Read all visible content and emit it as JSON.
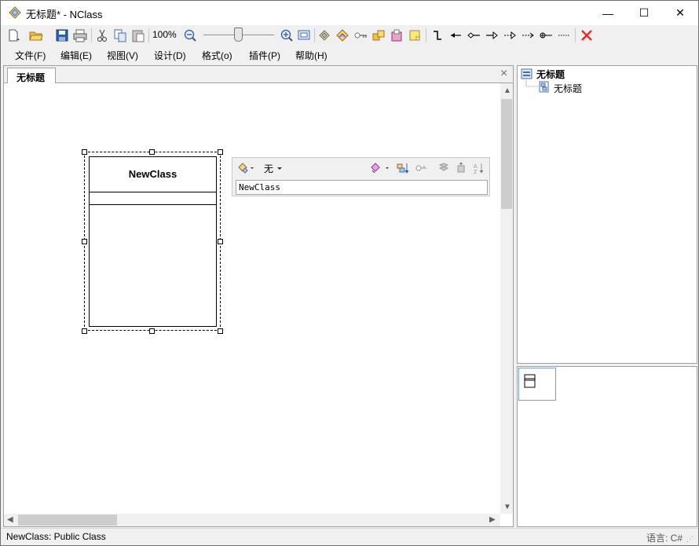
{
  "window": {
    "title": "无标题* - NClass",
    "minimize": "—",
    "maximize": "☐",
    "close": "✕"
  },
  "toolbar": {
    "zoom_label": "100%",
    "zoom_level": 100,
    "icons": [
      "new-document-icon",
      "open-folder-icon",
      "save-icon",
      "print-icon",
      "cut-icon",
      "copy-icon",
      "paste-icon",
      "zoom-out-icon",
      "zoom-in-icon",
      "auto-zoom-icon",
      "new-class-icon",
      "new-interface-icon",
      "new-association-icon",
      "new-composition-icon",
      "new-package-icon",
      "new-comment-icon",
      "connector-icon",
      "association-arrow-icon",
      "composition-arrow-icon",
      "generalization-arrow-icon",
      "realization-arrow-icon",
      "dependency-arrow-icon",
      "nesting-arrow-icon",
      "comment-link-icon",
      "delete-icon"
    ]
  },
  "menu": {
    "file": "文件(F)",
    "edit": "编辑(E)",
    "view": "视图(V)",
    "design": "设计(D)",
    "format": "格式(o)",
    "plugins": "插件(P)",
    "help": "帮助(H)"
  },
  "document": {
    "tab_label": "无标题",
    "tab_close": "×"
  },
  "diagram": {
    "class_name": "NewClass"
  },
  "editor": {
    "access_label": "无",
    "name_value": "NewClass"
  },
  "tree": {
    "root_label": "无标题",
    "child_label": "无标题"
  },
  "status": {
    "text": "NewClass: Public Class",
    "language": "语言: C#"
  },
  "colors": {
    "accent_red": "#e0302d",
    "background": "#f0f0f0",
    "selection_border": "#7a9cc6"
  }
}
